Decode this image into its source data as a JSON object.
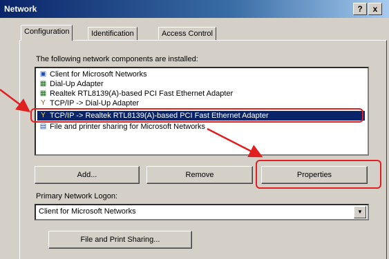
{
  "window": {
    "title": "Network"
  },
  "titlebar_buttons": {
    "help": "?",
    "close": "x"
  },
  "tabs": [
    {
      "label": "Configuration"
    },
    {
      "label": "Identification"
    },
    {
      "label": "Access Control"
    }
  ],
  "components": {
    "heading": "The following network components are installed:",
    "items": [
      {
        "label": "Client for Microsoft Networks",
        "icon": "client-icon"
      },
      {
        "label": "Dial-Up Adapter",
        "icon": "adapter-icon"
      },
      {
        "label": "Realtek RTL8139(A)-based PCI Fast Ethernet Adapter",
        "icon": "adapter-icon"
      },
      {
        "label": "TCP/IP -> Dial-Up Adapter",
        "icon": "protocol-icon"
      },
      {
        "label": "TCP/IP -> Realtek RTL8139(A)-based PCI Fast Ethernet Adapter",
        "icon": "protocol-icon",
        "selected": true
      },
      {
        "label": "File and printer sharing for Microsoft Networks",
        "icon": "service-icon"
      }
    ]
  },
  "buttons": {
    "add": "Add...",
    "remove": "Remove",
    "properties": "Properties",
    "file_print": "File and Print Sharing..."
  },
  "logon": {
    "label": "Primary Network Logon:",
    "value": "Client for Microsoft Networks"
  },
  "colors": {
    "selection": "#0a246a",
    "annotation": "#e02020"
  }
}
